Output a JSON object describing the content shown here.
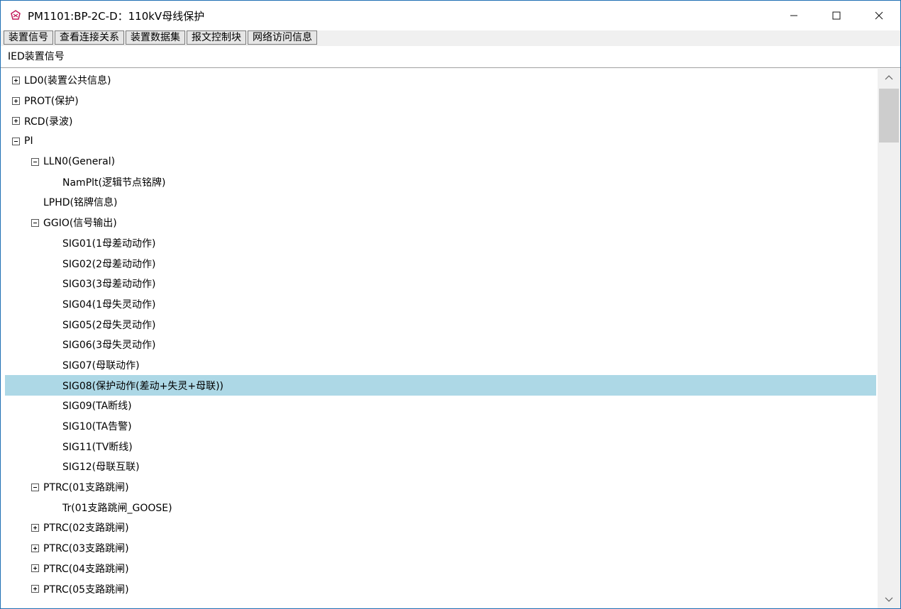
{
  "window": {
    "title": "PM1101:BP-2C-D：110kV母线保护"
  },
  "toolbar": {
    "tabs": [
      "装置信号",
      "查看连接关系",
      "装置数据集",
      "报文控制块",
      "网络访问信息"
    ]
  },
  "section_header": "IED装置信号",
  "tree": {
    "items": [
      {
        "label": "LD0(装置公共信息)",
        "level": 0,
        "expander": "plus"
      },
      {
        "label": "PROT(保护)",
        "level": 0,
        "expander": "plus"
      },
      {
        "label": "RCD(录波)",
        "level": 0,
        "expander": "plus"
      },
      {
        "label": "PI",
        "level": 0,
        "expander": "minus"
      },
      {
        "label": "LLN0(General)",
        "level": 1,
        "expander": "minus"
      },
      {
        "label": "NamPlt(逻辑节点铭牌)",
        "level": 2,
        "expander": "none"
      },
      {
        "label": "LPHD(铭牌信息)",
        "level": 1,
        "expander": "none"
      },
      {
        "label": "GGIO(信号输出)",
        "level": 1,
        "expander": "minus"
      },
      {
        "label": "SIG01(1母差动动作)",
        "level": 2,
        "expander": "none"
      },
      {
        "label": "SIG02(2母差动动作)",
        "level": 2,
        "expander": "none"
      },
      {
        "label": "SIG03(3母差动动作)",
        "level": 2,
        "expander": "none"
      },
      {
        "label": "SIG04(1母失灵动作)",
        "level": 2,
        "expander": "none"
      },
      {
        "label": "SIG05(2母失灵动作)",
        "level": 2,
        "expander": "none"
      },
      {
        "label": "SIG06(3母失灵动作)",
        "level": 2,
        "expander": "none"
      },
      {
        "label": "SIG07(母联动作)",
        "level": 2,
        "expander": "none"
      },
      {
        "label": "SIG08(保护动作(差动+失灵+母联))",
        "level": 2,
        "expander": "none",
        "selected": true
      },
      {
        "label": "SIG09(TA断线)",
        "level": 2,
        "expander": "none"
      },
      {
        "label": "SIG10(TA告警)",
        "level": 2,
        "expander": "none"
      },
      {
        "label": "SIG11(TV断线)",
        "level": 2,
        "expander": "none"
      },
      {
        "label": "SIG12(母联互联)",
        "level": 2,
        "expander": "none"
      },
      {
        "label": "PTRC(01支路跳闸)",
        "level": 1,
        "expander": "minus"
      },
      {
        "label": "Tr(01支路跳闸_GOOSE)",
        "level": 2,
        "expander": "none"
      },
      {
        "label": "PTRC(02支路跳闸)",
        "level": 1,
        "expander": "plus"
      },
      {
        "label": "PTRC(03支路跳闸)",
        "level": 1,
        "expander": "plus"
      },
      {
        "label": "PTRC(04支路跳闸)",
        "level": 1,
        "expander": "plus"
      },
      {
        "label": "PTRC(05支路跳闸)",
        "level": 1,
        "expander": "plus"
      }
    ]
  },
  "colors": {
    "selection": "#add8e6",
    "window_border": "#1f6fb3"
  },
  "icons": {
    "app": "app-icon",
    "minimize": "minimize-icon",
    "maximize": "maximize-icon",
    "close": "close-icon"
  }
}
